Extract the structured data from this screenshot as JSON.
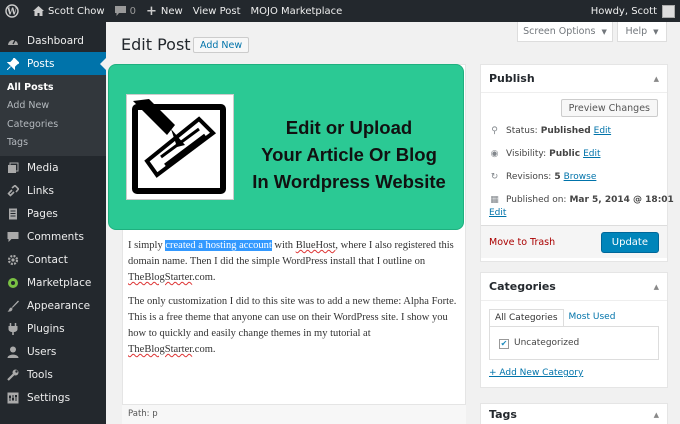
{
  "admin_bar": {
    "site_name": "Scott Chow",
    "comments_count": "0",
    "new_label": "New",
    "view_post_label": "View Post",
    "mojo_label": "MOJO Marketplace",
    "greeting": "Howdy, Scott"
  },
  "sidebar": {
    "items": [
      {
        "label": "Dashboard",
        "icon": "dashboard-icon"
      },
      {
        "label": "Posts",
        "icon": "pin-icon"
      },
      {
        "label": "Media",
        "icon": "media-icon"
      },
      {
        "label": "Links",
        "icon": "link-icon"
      },
      {
        "label": "Pages",
        "icon": "page-icon"
      },
      {
        "label": "Comments",
        "icon": "comment-icon"
      },
      {
        "label": "Contact",
        "icon": "gear-icon"
      },
      {
        "label": "Marketplace",
        "icon": "marketplace-icon"
      },
      {
        "label": "Appearance",
        "icon": "brush-icon"
      },
      {
        "label": "Plugins",
        "icon": "plug-icon"
      },
      {
        "label": "Users",
        "icon": "user-icon"
      },
      {
        "label": "Tools",
        "icon": "wrench-icon"
      },
      {
        "label": "Settings",
        "icon": "settings-icon"
      }
    ],
    "posts_submenu": [
      "All Posts",
      "Add New",
      "Categories",
      "Tags"
    ]
  },
  "header": {
    "title": "Edit Post",
    "add_new_label": "Add New",
    "screen_options_label": "Screen Options",
    "help_label": "Help"
  },
  "banner": {
    "line1": "Edit or Upload",
    "line2": "Your Article Or Blog",
    "line3": "In Wordpress Website"
  },
  "editor": {
    "p1_before": "I simply ",
    "p1_link": "created a hosting account",
    "p1_mid": " with ",
    "p1_bluehost": "BlueHost",
    "p1_after": ", where I also registered this domain name.  Then I did the simple WordPress install that I outline on ",
    "p1_site": "TheBlogStarter",
    "p1_end": ".com.",
    "p2_text": "The only customization I did to this site was to add a new theme: Alpha Forte.  This is a free theme that anyone can use on their WordPress site.  I show you how to quickly and easily change themes in my tutorial at ",
    "p2_site": "TheBlogStarter",
    "p2_end": ".com.",
    "path": "Path: p"
  },
  "publish": {
    "title": "Publish",
    "preview_label": "Preview Changes",
    "status_label": "Status:",
    "status_value": "Published",
    "visibility_label": "Visibility:",
    "visibility_value": "Public",
    "revisions_label": "Revisions:",
    "revisions_value": "5",
    "browse_label": "Browse",
    "published_label": "Published on:",
    "published_value": "Mar 5, 2014 @ 18:01",
    "edit_label": "Edit",
    "trash_label": "Move to Trash",
    "update_label": "Update"
  },
  "categories": {
    "title": "Categories",
    "tab_all": "All Categories",
    "tab_used": "Most Used",
    "item": "Uncategorized",
    "add_new": "+ Add New Category"
  },
  "tags": {
    "title": "Tags"
  }
}
